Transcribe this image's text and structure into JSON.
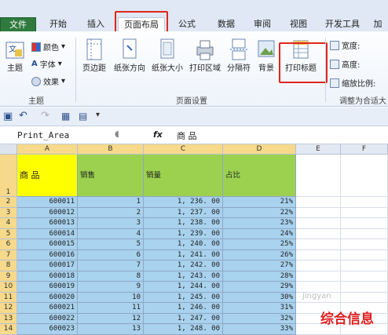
{
  "ribbon_tabs": [
    {
      "label": "文件"
    },
    {
      "label": "开始"
    },
    {
      "label": "插入"
    },
    {
      "label": "页面布局"
    },
    {
      "label": "公式"
    },
    {
      "label": "数据"
    },
    {
      "label": "审阅"
    },
    {
      "label": "视图"
    },
    {
      "label": "开发工具"
    },
    {
      "label": "加"
    }
  ],
  "theme_group": {
    "label": "主题",
    "themes_button": "主题",
    "colors": "颜色",
    "fonts": "字体",
    "effects": "效果"
  },
  "page_setup_group": {
    "label": "页面设置",
    "margins": "页边距",
    "orientation": "纸张方向",
    "size": "纸张大小",
    "print_area": "打印区域",
    "breaks": "分隔符",
    "background": "背景",
    "print_titles": "打印标题"
  },
  "scale_group": {
    "label": "调整为合适大",
    "width": "宽度:",
    "height": "高度:",
    "scale": "缩放比例:"
  },
  "formula_bar": {
    "name_box": "Print_Area",
    "fx": "fx",
    "content": "商      品"
  },
  "columns": [
    "A",
    "B",
    "C",
    "D",
    "E",
    "F"
  ],
  "header_row": {
    "row": "1",
    "a": "商      品",
    "b": "销售",
    "c": "销量",
    "d": "占比"
  },
  "rows": [
    {
      "row": "2",
      "a": "600011",
      "b": "1",
      "c": "1, 236. 00",
      "d": "21%"
    },
    {
      "row": "3",
      "a": "600012",
      "b": "2",
      "c": "1, 237. 00",
      "d": "22%"
    },
    {
      "row": "4",
      "a": "600013",
      "b": "3",
      "c": "1, 238. 00",
      "d": "23%"
    },
    {
      "row": "5",
      "a": "600014",
      "b": "4",
      "c": "1, 239. 00",
      "d": "24%"
    },
    {
      "row": "6",
      "a": "600015",
      "b": "5",
      "c": "1, 240. 00",
      "d": "25%"
    },
    {
      "row": "7",
      "a": "600016",
      "b": "6",
      "c": "1, 241. 00",
      "d": "26%"
    },
    {
      "row": "8",
      "a": "600017",
      "b": "7",
      "c": "1, 242. 00",
      "d": "27%"
    },
    {
      "row": "9",
      "a": "600018",
      "b": "8",
      "c": "1, 243. 00",
      "d": "28%"
    },
    {
      "row": "10",
      "a": "600019",
      "b": "9",
      "c": "1, 244. 00",
      "d": "29%"
    },
    {
      "row": "11",
      "a": "600020",
      "b": "10",
      "c": "1, 245. 00",
      "d": "30%"
    },
    {
      "row": "12",
      "a": "600021",
      "b": "11",
      "c": "1, 246. 00",
      "d": "31%"
    },
    {
      "row": "13",
      "a": "600022",
      "b": "12",
      "c": "1, 247. 00",
      "d": "32%"
    },
    {
      "row": "14",
      "a": "600023",
      "b": "13",
      "c": "1, 248. 00",
      "d": "33%"
    }
  ],
  "watermark": "综合信息",
  "watermark_small": "jingyan"
}
